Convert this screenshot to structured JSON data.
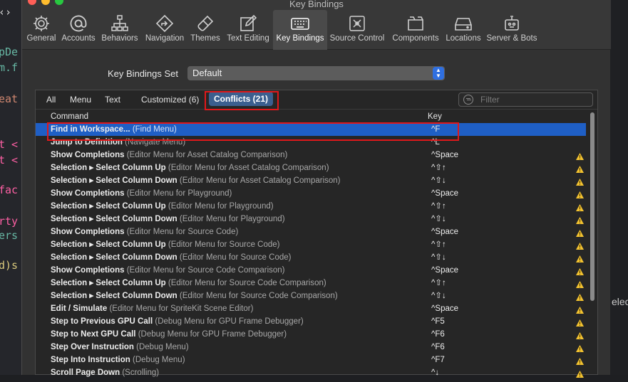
{
  "window": {
    "title": "Key Bindings"
  },
  "background": {
    "code_lines": [
      {
        "text": "‹›",
        "color": "#d8d8d8"
      },
      {
        "text": "pDe",
        "color": "#67b7a4"
      },
      {
        "text": "m.f",
        "color": "#67b7a4"
      },
      {
        "text": "eat",
        "color": "#d08770"
      },
      {
        "text": "t <",
        "color": "#fc5fa3"
      },
      {
        "text": "t <",
        "color": "#fc5fa3"
      },
      {
        "text": "fac",
        "color": "#fc5fa3"
      },
      {
        "text": "rty",
        "color": "#fc5fa3"
      },
      {
        "text": "ers",
        "color": "#67b7a4"
      },
      {
        "text": "d)s",
        "color": "#d9c97c"
      }
    ],
    "right_text": "elec"
  },
  "toolbar": {
    "items": [
      {
        "label": "General",
        "icon": "gear-icon"
      },
      {
        "label": "Accounts",
        "icon": "at-sign-icon"
      },
      {
        "label": "Behaviors",
        "icon": "hierarchy-icon"
      },
      {
        "label": "Navigation",
        "icon": "navigation-diamond-icon"
      },
      {
        "label": "Themes",
        "icon": "paintbrush-icon"
      },
      {
        "label": "Text Editing",
        "icon": "pencil-square-icon"
      },
      {
        "label": "Key Bindings",
        "icon": "keyboard-icon"
      },
      {
        "label": "Source Control",
        "icon": "source-control-icon"
      },
      {
        "label": "Components",
        "icon": "components-box-icon"
      },
      {
        "label": "Locations",
        "icon": "drive-icon"
      },
      {
        "label": "Server & Bots",
        "icon": "robot-icon"
      }
    ],
    "active_index": 6
  },
  "key_bindings_set": {
    "label": "Key Bindings Set",
    "value": "Default"
  },
  "filter_tabs": [
    "All",
    "Menu",
    "Text",
    "Customized (6)",
    "Conflicts (21)"
  ],
  "filter_tabs_selected": "Conflicts (21)",
  "search": {
    "placeholder": "Filter"
  },
  "columns": {
    "command": "Command",
    "key": "Key"
  },
  "rows": [
    {
      "name": "Find in Workspace...",
      "context": "(Find Menu)",
      "key": "^F",
      "selected": true,
      "warning": false
    },
    {
      "name": "Jump to Definition",
      "context": "(Navigate Menu)",
      "key": "^L",
      "selected": false,
      "warning": false
    },
    {
      "name": "Show Completions",
      "context": "(Editor Menu for Asset Catalog Comparison)",
      "key": "^Space",
      "warning": true
    },
    {
      "name": "Selection ▸ Select Column Up",
      "context": "(Editor Menu for Asset Catalog Comparison)",
      "key": "^⇧↑",
      "warning": true
    },
    {
      "name": "Selection ▸ Select Column Down",
      "context": "(Editor Menu for Asset Catalog Comparison)",
      "key": "^⇧↓",
      "warning": true
    },
    {
      "name": "Show Completions",
      "context": "(Editor Menu for Playground)",
      "key": "^Space",
      "warning": true
    },
    {
      "name": "Selection ▸ Select Column Up",
      "context": "(Editor Menu for Playground)",
      "key": "^⇧↑",
      "warning": true
    },
    {
      "name": "Selection ▸ Select Column Down",
      "context": "(Editor Menu for Playground)",
      "key": "^⇧↓",
      "warning": true
    },
    {
      "name": "Show Completions",
      "context": "(Editor Menu for Source Code)",
      "key": "^Space",
      "warning": true
    },
    {
      "name": "Selection ▸ Select Column Up",
      "context": "(Editor Menu for Source Code)",
      "key": "^⇧↑",
      "warning": true
    },
    {
      "name": "Selection ▸ Select Column Down",
      "context": "(Editor Menu for Source Code)",
      "key": "^⇧↓",
      "warning": true
    },
    {
      "name": "Show Completions",
      "context": "(Editor Menu for Source Code Comparison)",
      "key": "^Space",
      "warning": true
    },
    {
      "name": "Selection ▸ Select Column Up",
      "context": "(Editor Menu for Source Code Comparison)",
      "key": "^⇧↑",
      "warning": true
    },
    {
      "name": "Selection ▸ Select Column Down",
      "context": "(Editor Menu for Source Code Comparison)",
      "key": "^⇧↓",
      "warning": true
    },
    {
      "name": "Edit / Simulate",
      "context": "(Editor Menu for SpriteKit Scene Editor)",
      "key": "^Space",
      "warning": true
    },
    {
      "name": "Step to Previous GPU Call",
      "context": "(Debug Menu for GPU Frame Debugger)",
      "key": "^F5",
      "warning": true
    },
    {
      "name": "Step to Next GPU Call",
      "context": "(Debug Menu for GPU Frame Debugger)",
      "key": "^F6",
      "warning": true
    },
    {
      "name": "Step Over Instruction",
      "context": "(Debug Menu)",
      "key": "^F6",
      "warning": true
    },
    {
      "name": "Step Into Instruction",
      "context": "(Debug Menu)",
      "key": "^F7",
      "warning": true
    },
    {
      "name": "Scroll Page Down",
      "context": "(Scrolling)",
      "key": "^↓",
      "warning": true
    }
  ],
  "colors": {
    "accent": "#2f6fe0",
    "selected_row": "#1f5fc5",
    "selected_tab": "#3b5f8f",
    "highlight_box": "#e0181b",
    "warning": "#f2c230"
  }
}
